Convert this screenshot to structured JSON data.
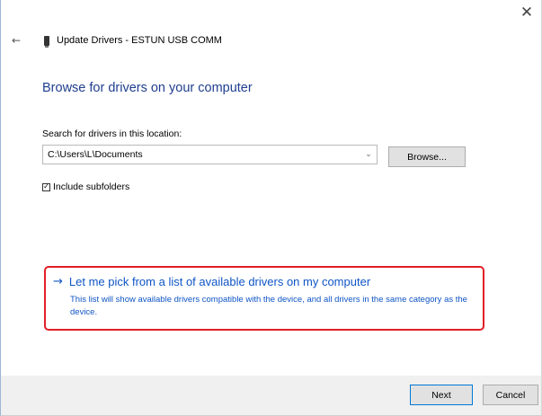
{
  "window": {
    "title": "Update Drivers - ESTUN USB COMM",
    "close_glyph": "✕",
    "back_glyph": "←",
    "device_icon": "usb-device-icon"
  },
  "page": {
    "heading": "Browse for drivers on your computer"
  },
  "search": {
    "label": "Search for drivers in this location:",
    "path_value": "C:\\Users\\L\\Documents",
    "combo_arrow": "⌄",
    "browse_label": "Browse..."
  },
  "subfolders": {
    "checked": true,
    "check_glyph": "✓",
    "label": "Include subfolders"
  },
  "pick_option": {
    "arrow": "→",
    "title": "Let me pick from a list of available drivers on my computer",
    "description": "This list will show available drivers compatible with the device, and all drivers in the same category as the device.",
    "highlight_color": "#e21e26",
    "link_color": "#0f55c5"
  },
  "footer": {
    "next_label": "Next",
    "cancel_label": "Cancel"
  }
}
